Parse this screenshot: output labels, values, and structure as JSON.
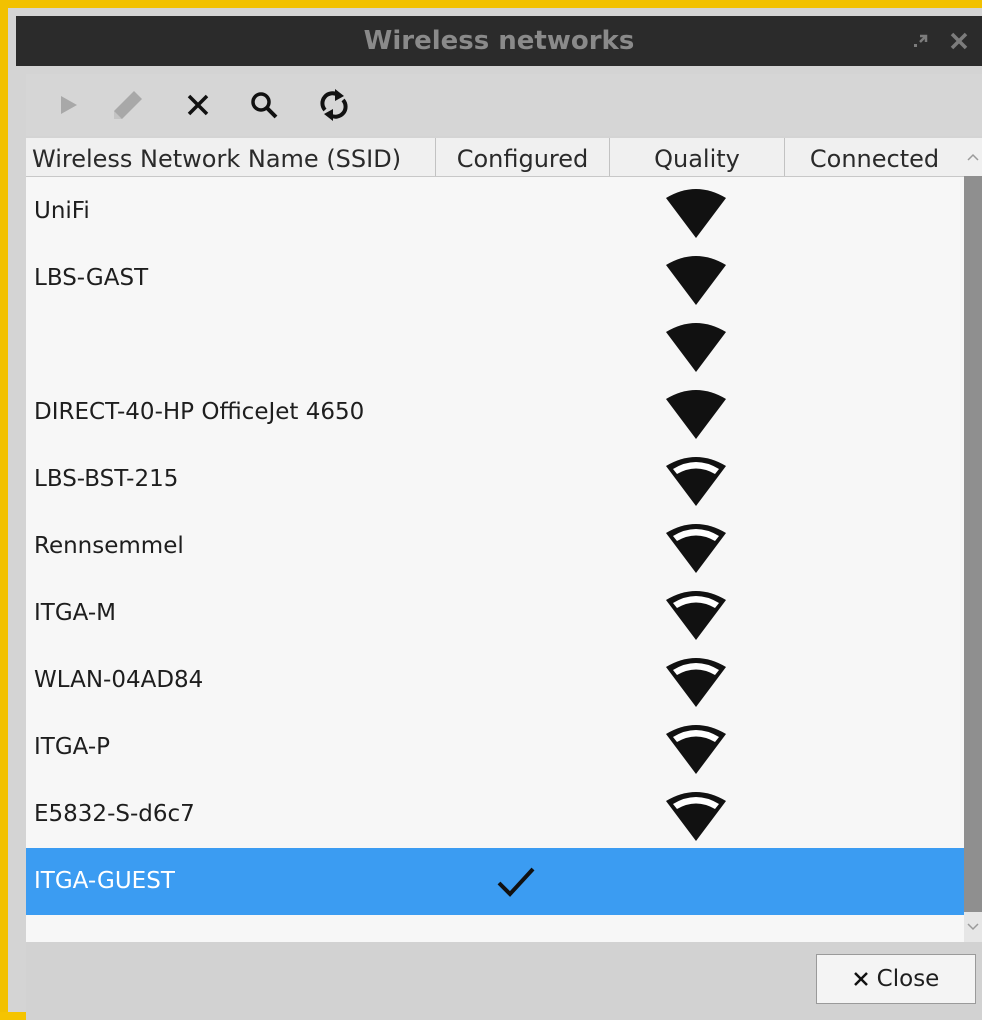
{
  "window": {
    "title": "Wireless networks"
  },
  "toolbar": {
    "tools": [
      {
        "name": "connect",
        "icon": "play-icon",
        "enabled": false
      },
      {
        "name": "edit",
        "icon": "pencil-icon",
        "enabled": false
      },
      {
        "name": "delete",
        "icon": "x-icon",
        "enabled": true
      },
      {
        "name": "search",
        "icon": "search-icon",
        "enabled": true
      },
      {
        "name": "refresh",
        "icon": "refresh-icon",
        "enabled": true
      }
    ]
  },
  "table": {
    "columns": [
      "Wireless Network Name (SSID)",
      "Configured",
      "Quality",
      "Connected"
    ],
    "rows": [
      {
        "ssid": "UniFi",
        "configured": false,
        "quality": "full",
        "connected": false,
        "selected": false
      },
      {
        "ssid": "LBS-GAST",
        "configured": false,
        "quality": "full",
        "connected": false,
        "selected": false
      },
      {
        "ssid": "",
        "configured": false,
        "quality": "full",
        "connected": false,
        "selected": false
      },
      {
        "ssid": "DIRECT-40-HP OfficeJet 4650",
        "configured": false,
        "quality": "full",
        "connected": false,
        "selected": false
      },
      {
        "ssid": "LBS-BST-215",
        "configured": false,
        "quality": "partial",
        "connected": false,
        "selected": false
      },
      {
        "ssid": "Rennsemmel",
        "configured": false,
        "quality": "partial",
        "connected": false,
        "selected": false
      },
      {
        "ssid": "ITGA-M",
        "configured": false,
        "quality": "partial",
        "connected": false,
        "selected": false
      },
      {
        "ssid": "WLAN-04AD84",
        "configured": false,
        "quality": "partial",
        "connected": false,
        "selected": false
      },
      {
        "ssid": "ITGA-P",
        "configured": false,
        "quality": "partial",
        "connected": false,
        "selected": false
      },
      {
        "ssid": "E5832-S-d6c7",
        "configured": false,
        "quality": "partial",
        "connected": false,
        "selected": false
      },
      {
        "ssid": "ITGA-GUEST",
        "configured": true,
        "quality": "none",
        "connected": false,
        "selected": true
      }
    ]
  },
  "footer": {
    "close_label": "Close"
  },
  "colors": {
    "accent": "#3b9cf2",
    "titlebar": "#2b2b2b",
    "frame": "#f2c100"
  }
}
